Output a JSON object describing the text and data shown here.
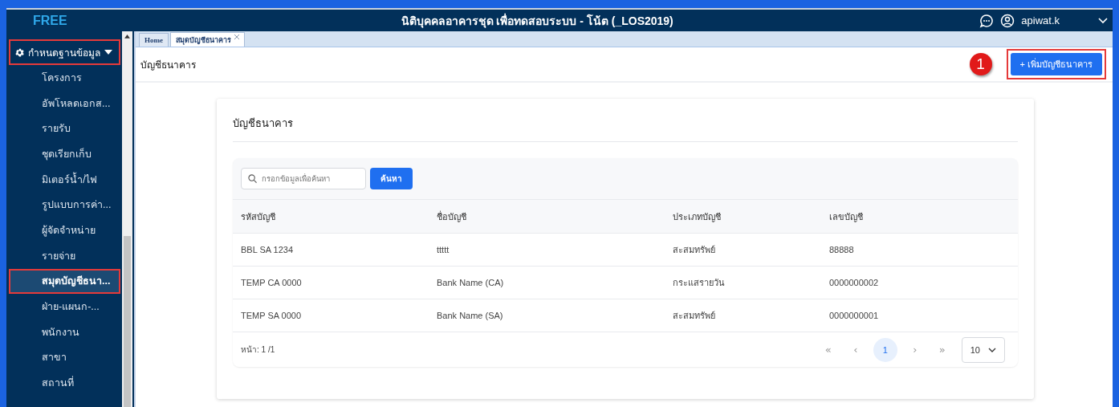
{
  "header": {
    "brand": "FREE",
    "title": "นิติบุคคลอาคารชุด เพื่อทดสอบระบบ - โน้ต (_LOS2019)",
    "user": "apiwat.k"
  },
  "sidebar": {
    "group": {
      "label": "กำหนดฐานข้อมูล",
      "expanded": true,
      "highlighted": true
    },
    "items": [
      {
        "label": "โครงการ",
        "selected": false,
        "highlighted": false
      },
      {
        "label": "อัพโหลดเอกส...",
        "selected": false,
        "highlighted": false
      },
      {
        "label": "รายรับ",
        "selected": false,
        "highlighted": false
      },
      {
        "label": "ชุดเรียกเก็บ",
        "selected": false,
        "highlighted": false
      },
      {
        "label": "มิเตอร์น้ำ/ไฟ",
        "selected": false,
        "highlighted": false
      },
      {
        "label": "รูปแบบการค่า...",
        "selected": false,
        "highlighted": false
      },
      {
        "label": "ผู้จัดจำหน่าย",
        "selected": false,
        "highlighted": false
      },
      {
        "label": "รายจ่าย",
        "selected": false,
        "highlighted": false
      },
      {
        "label": "สมุดบัญชีธนา...",
        "selected": true,
        "highlighted": true
      },
      {
        "label": "ฝ่าย-แผนก-...",
        "selected": false,
        "highlighted": false
      },
      {
        "label": "พนักงาน",
        "selected": false,
        "highlighted": false
      },
      {
        "label": "สาขา",
        "selected": false,
        "highlighted": false
      },
      {
        "label": "สถานที่",
        "selected": false,
        "highlighted": false
      }
    ]
  },
  "tabs": [
    {
      "label": "Home",
      "selected": false,
      "closable": false
    },
    {
      "label": "สมุดบัญชีธนาคาร",
      "selected": true,
      "closable": true
    }
  ],
  "page": {
    "title": "บัญชีธนาคาร",
    "add_button": {
      "label": "+ เพิ่มบัญชีธนาคาร",
      "highlighted": true,
      "callout": "1"
    }
  },
  "card": {
    "title": "บัญชีธนาคาร",
    "search": {
      "placeholder": "กรอกข้อมูลเพื่อค้นหา",
      "button": "ค้นหา"
    },
    "table": {
      "columns": [
        "รหัสบัญชี",
        "ชื่อบัญชี",
        "ประเภทบัญชี",
        "เลขบัญชี"
      ],
      "rows": [
        [
          "BBL SA 1234",
          "ttttt",
          "สะสมทรัพย์",
          "88888"
        ],
        [
          "TEMP CA 0000",
          "Bank Name (CA)",
          "กระแสรายวัน",
          "0000000002"
        ],
        [
          "TEMP SA 0000",
          "Bank Name (SA)",
          "สะสมทรัพย์",
          "0000000001"
        ]
      ]
    },
    "pager": {
      "info": "หน้า: 1 /1",
      "first": "«",
      "prev": "‹",
      "pages": [
        {
          "label": "1",
          "selected": true
        }
      ],
      "next": "›",
      "last": "»",
      "page_size": "10"
    }
  }
}
